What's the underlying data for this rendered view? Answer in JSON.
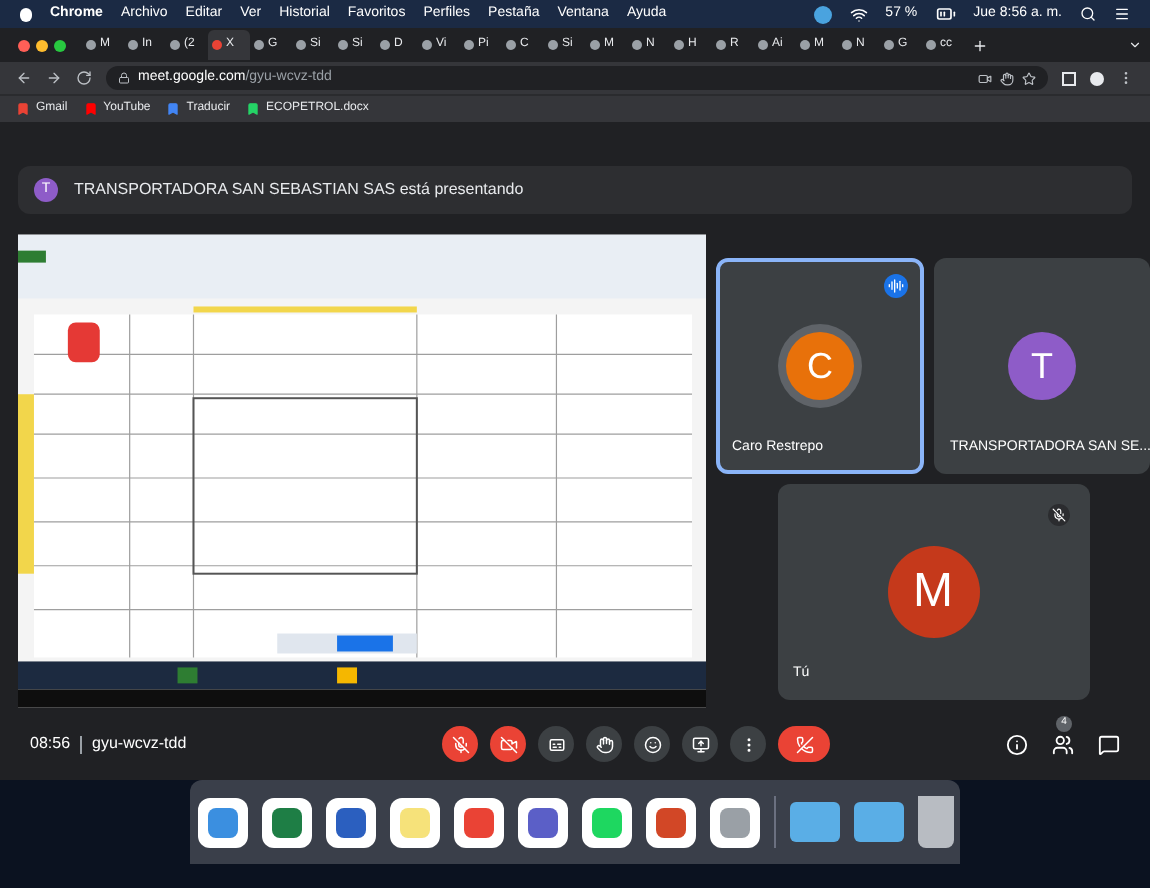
{
  "menu_bar": {
    "app": "Chrome",
    "items": [
      "Archivo",
      "Editar",
      "Ver",
      "Historial",
      "Favoritos",
      "Perfiles",
      "Pestaña",
      "Ventana",
      "Ayuda"
    ],
    "battery": "57 %",
    "clock": "Jue 8:56 a. m."
  },
  "tabs": [
    {
      "label": "M",
      "selected": false
    },
    {
      "label": "In",
      "selected": false
    },
    {
      "label": "(2",
      "selected": false
    },
    {
      "label": "X",
      "selected": true
    },
    {
      "label": "G",
      "selected": false
    },
    {
      "label": "Si",
      "selected": false
    },
    {
      "label": "Si",
      "selected": false
    },
    {
      "label": "D",
      "selected": false
    },
    {
      "label": "Vi",
      "selected": false
    },
    {
      "label": "Pi",
      "selected": false
    },
    {
      "label": "C",
      "selected": false
    },
    {
      "label": "Si",
      "selected": false
    },
    {
      "label": "M",
      "selected": false
    },
    {
      "label": "N",
      "selected": false
    },
    {
      "label": "H",
      "selected": false
    },
    {
      "label": "R",
      "selected": false
    },
    {
      "label": "Ai",
      "selected": false
    },
    {
      "label": "M",
      "selected": false
    },
    {
      "label": "N",
      "selected": false
    },
    {
      "label": "G",
      "selected": false
    },
    {
      "label": "cc",
      "selected": false
    }
  ],
  "address_bar": {
    "host": "meet.google.com",
    "path": "/gyu-wcvz-tdd"
  },
  "bookmarks": [
    {
      "label": "Gmail",
      "color": "#ea4335"
    },
    {
      "label": "YouTube",
      "color": "#ff0000"
    },
    {
      "label": "Traducir",
      "color": "#4285f4"
    },
    {
      "label": "ECOPETROL.docx",
      "color": "#25d366"
    }
  ],
  "banner": {
    "initial": "T",
    "text": "TRANSPORTADORA SAN SEBASTIAN SAS está presentando"
  },
  "participants": [
    {
      "name": "Caro Restrepo",
      "initial": "C",
      "color": "#e8710a",
      "speaking": true,
      "muted": false
    },
    {
      "name": "TRANSPORTADORA SAN SE...",
      "initial": "T",
      "color": "#8e5cc8",
      "speaking": false,
      "muted": false
    },
    {
      "name": "Tú",
      "initial": "M",
      "color": "#c5391b",
      "speaking": false,
      "muted": true
    }
  ],
  "bottom_bar": {
    "time": "08:56",
    "meeting_code": "gyu-wcvz-tdd",
    "people_count": "4"
  },
  "controls": [
    {
      "kind": "mic",
      "on": false
    },
    {
      "kind": "camera",
      "on": false
    },
    {
      "kind": "captions"
    },
    {
      "kind": "hand"
    },
    {
      "kind": "emoji"
    },
    {
      "kind": "present"
    },
    {
      "kind": "more"
    },
    {
      "kind": "hangup"
    }
  ]
}
